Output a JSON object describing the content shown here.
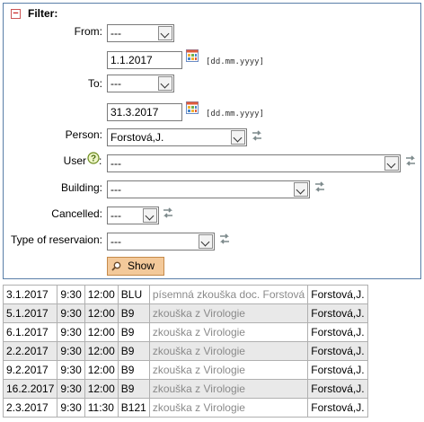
{
  "filter": {
    "title": "Filter:",
    "toggle_symbol": "−",
    "from_label": "From:",
    "from_select": "---",
    "from_date": "1.1.2017",
    "date_format": "[dd.mm.yyyy]",
    "to_label": "To:",
    "to_select": "---",
    "to_date": "31.3.2017",
    "person_label": "Person:",
    "person_value": "Forstová,J.",
    "user_label": "User",
    "user_value": "---",
    "building_label": "Building:",
    "building_value": "---",
    "cancelled_label": "Cancelled:",
    "cancelled_value": "---",
    "type_label": "Type of reservaion:",
    "type_value": "---",
    "show_label": "Show"
  },
  "results": [
    {
      "date": "3.1.2017",
      "start": "9:30",
      "end": "12:00",
      "building": "BLU",
      "desc": "písemná zkouška doc. Forstová",
      "person": "Forstová,J."
    },
    {
      "date": "5.1.2017",
      "start": "9:30",
      "end": "12:00",
      "building": "B9",
      "desc": "zkouška z Virologie",
      "person": "Forstová,J."
    },
    {
      "date": "6.1.2017",
      "start": "9:30",
      "end": "12:00",
      "building": "B9",
      "desc": "zkouška z Virologie",
      "person": "Forstová,J."
    },
    {
      "date": "2.2.2017",
      "start": "9:30",
      "end": "12:00",
      "building": "B9",
      "desc": "zkouška z Virologie",
      "person": "Forstová,J."
    },
    {
      "date": "9.2.2017",
      "start": "9:30",
      "end": "12:00",
      "building": "B9",
      "desc": "zkouška z Virologie",
      "person": "Forstová,J."
    },
    {
      "date": "16.2.2017",
      "start": "9:30",
      "end": "12:00",
      "building": "B9",
      "desc": "zkouška z Virologie",
      "person": "Forstová,J."
    },
    {
      "date": "2.3.2017",
      "start": "9:30",
      "end": "11:30",
      "building": "B121",
      "desc": "zkouška z Virologie",
      "person": "Forstová,J."
    }
  ]
}
